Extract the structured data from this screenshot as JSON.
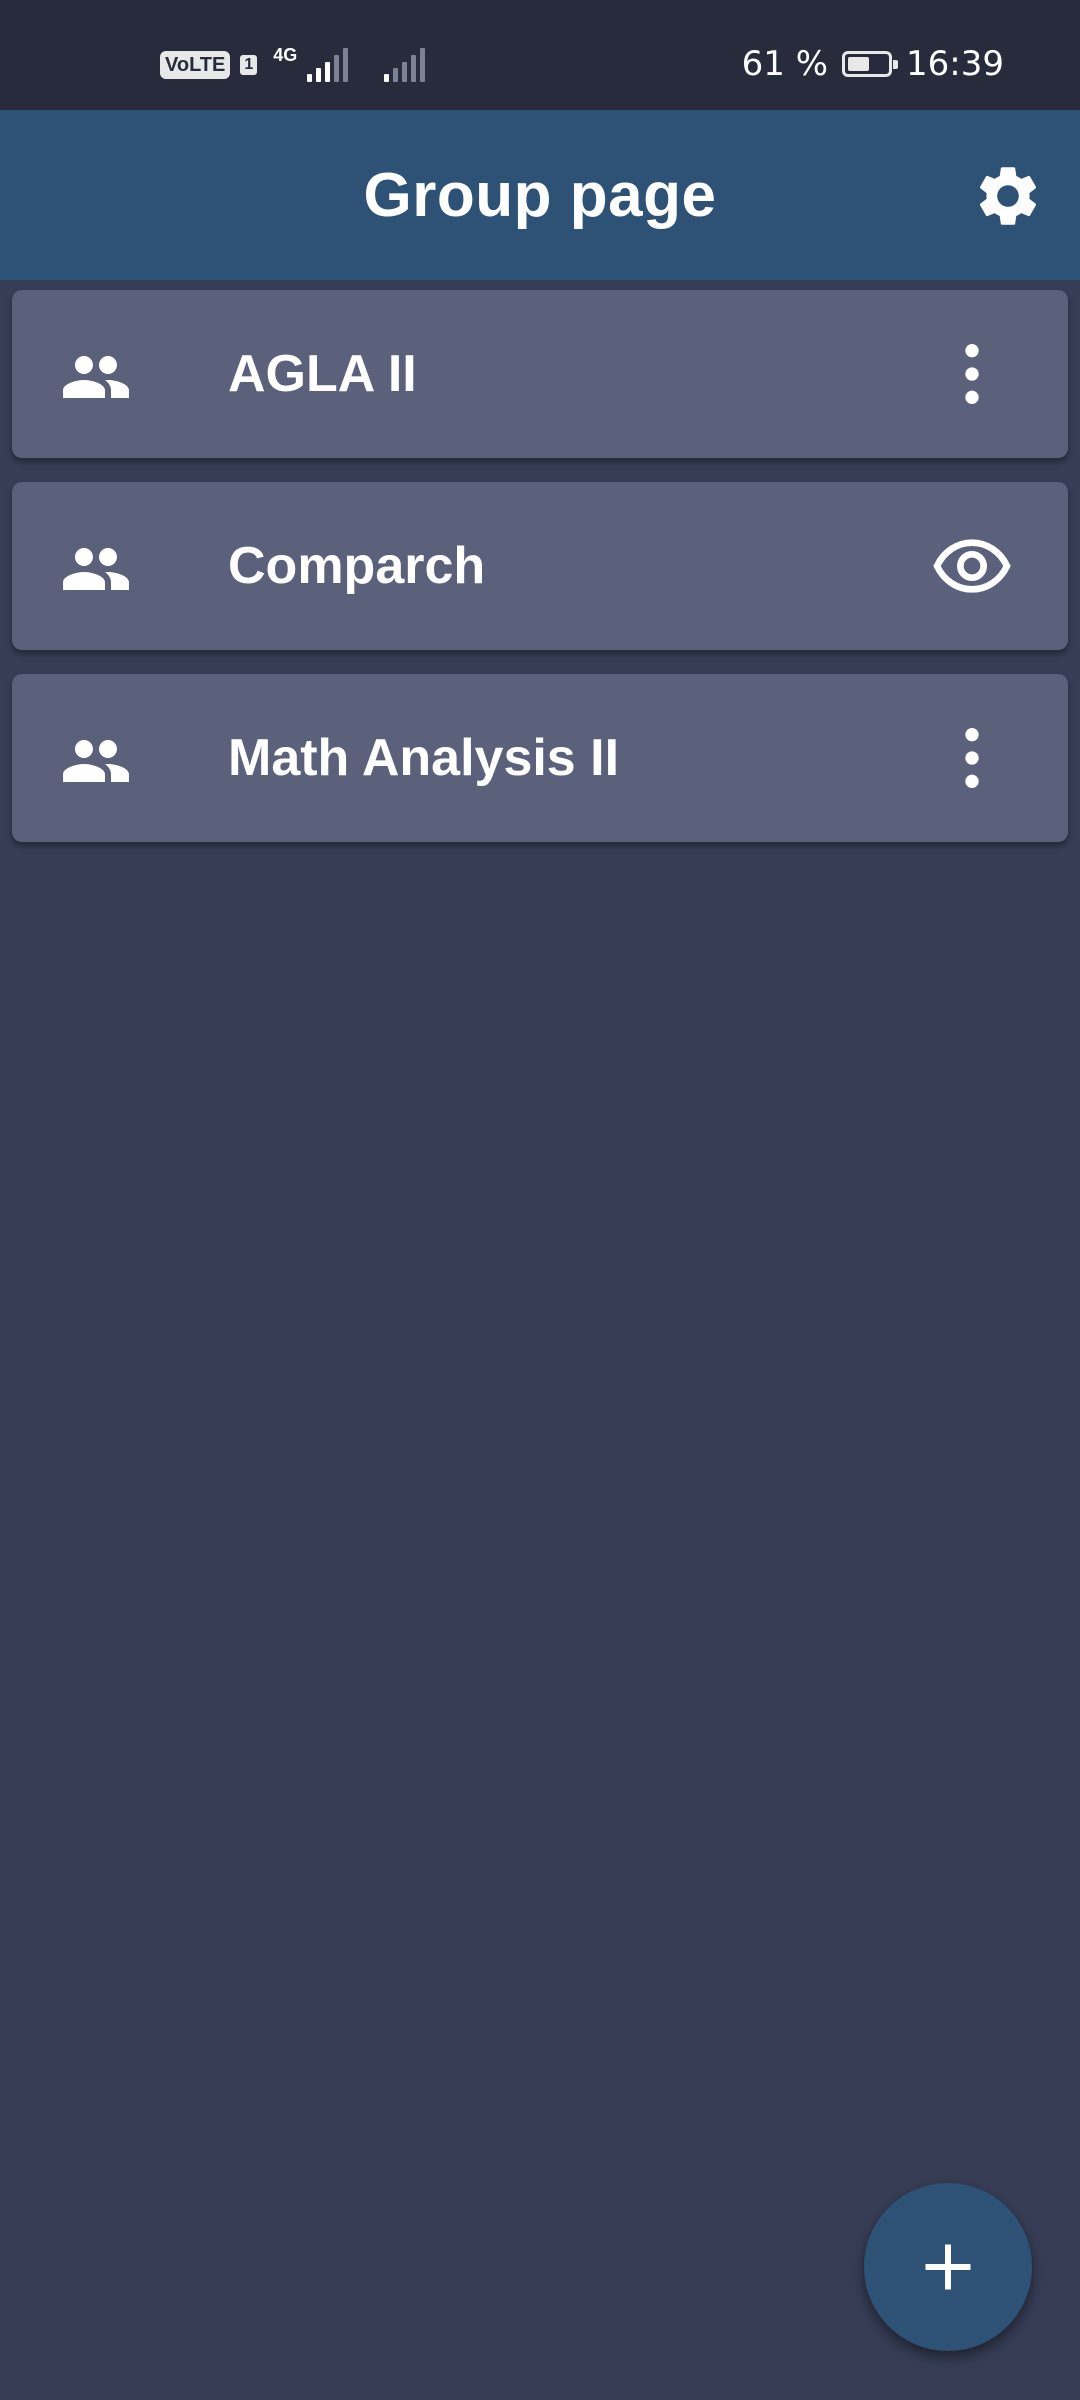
{
  "status_bar": {
    "volte": "VoLTE",
    "sim": "1",
    "network": "4G",
    "battery_text": "61 %",
    "battery_level": 0.61,
    "time": "16:39"
  },
  "header": {
    "title": "Group page",
    "settings_icon": "gear-icon"
  },
  "groups": [
    {
      "name": "AGLA II",
      "icon": "group-icon",
      "action_icon": "more-vert-icon"
    },
    {
      "name": "Comparch",
      "icon": "group-icon",
      "action_icon": "eye-icon"
    },
    {
      "name": "Math Analysis II",
      "icon": "group-icon",
      "action_icon": "more-vert-icon"
    }
  ],
  "fab": {
    "icon": "plus-icon"
  },
  "colors": {
    "background": "#363d55",
    "status_bar": "#272b3c",
    "app_bar": "#2e5276",
    "card": "#5b617a",
    "fab": "#2e5276",
    "text": "#ffffff"
  }
}
